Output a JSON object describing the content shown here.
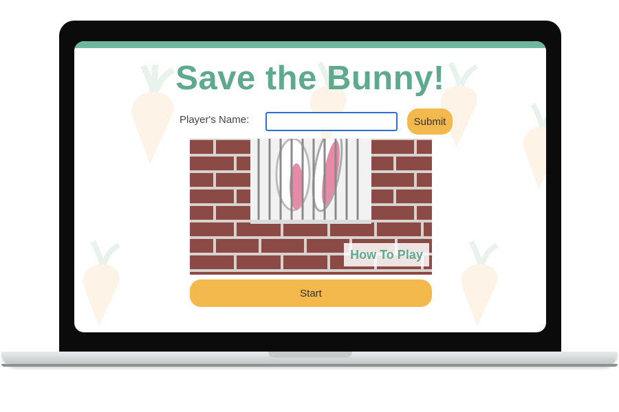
{
  "game": {
    "title": "Save the Bunny!",
    "name_label": "Player's Name:",
    "name_value": "",
    "submit_label": "Submit",
    "how_to_play_label": "How To Play",
    "start_label": "Start"
  },
  "colors": {
    "accent_green": "#5fa98e",
    "button_yellow": "#f4b94d",
    "brick": "#8a4a45",
    "input_focus": "#2b6fd6"
  },
  "icons": [
    "carrot-icon",
    "bunny-ears-icon",
    "jail-bars-icon"
  ]
}
